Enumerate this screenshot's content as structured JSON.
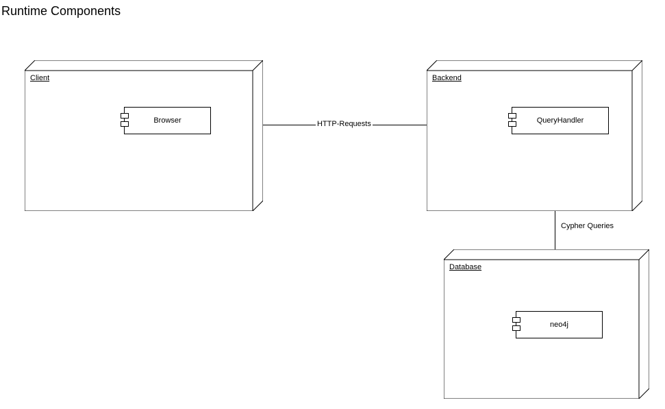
{
  "title": "Runtime Components",
  "nodes": {
    "client": {
      "label": "Client",
      "component": {
        "label": "Browser"
      }
    },
    "backend": {
      "label": "Backend",
      "component": {
        "label": "QueryHandler"
      }
    },
    "database": {
      "label": "Database",
      "component": {
        "label": "neo4j"
      }
    }
  },
  "edges": {
    "client_backend": {
      "label": "HTTP-Requests"
    },
    "backend_database": {
      "label": "Cypher Queries"
    }
  }
}
